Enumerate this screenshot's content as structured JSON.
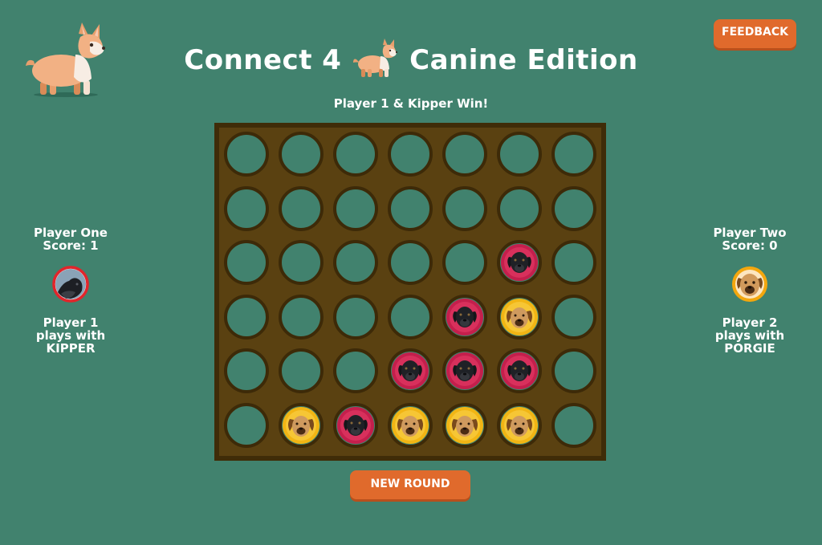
{
  "header": {
    "title_part1": "Connect 4",
    "title_part2": "Canine Edition",
    "feedback_label": "FEEDBACK"
  },
  "status": "Player 1 & Kipper Win!",
  "players": [
    {
      "name": "Player One",
      "score": "Score: 1",
      "plays_line1": "Player 1",
      "plays_line2": "plays with",
      "dog": "KIPPER",
      "token_color": "#e1252b"
    },
    {
      "name": "Player Two",
      "score": "Score: 0",
      "plays_line1": "Player 2",
      "plays_line2": "plays with",
      "dog": "PORGIE",
      "token_color": "#f3a70e"
    }
  ],
  "board": {
    "rows": 6,
    "cols": 7,
    "grid": [
      [
        0,
        0,
        0,
        0,
        0,
        0,
        0
      ],
      [
        0,
        0,
        0,
        0,
        0,
        0,
        0
      ],
      [
        0,
        0,
        0,
        0,
        0,
        1,
        0
      ],
      [
        0,
        0,
        0,
        0,
        1,
        2,
        0
      ],
      [
        0,
        0,
        0,
        1,
        1,
        1,
        0
      ],
      [
        0,
        2,
        1,
        2,
        2,
        2,
        0
      ]
    ]
  },
  "new_round_label": "NEW ROUND",
  "colors": {
    "background": "#41826e",
    "board": "#5a4111",
    "accent": "#e06a2c",
    "kipper_disc": "#c41f4c",
    "porgie_disc": "#f1b514"
  },
  "icons": {
    "logo": "corgi-icon",
    "kipper": "black-dog-face",
    "porgie": "tan-dog-face"
  }
}
